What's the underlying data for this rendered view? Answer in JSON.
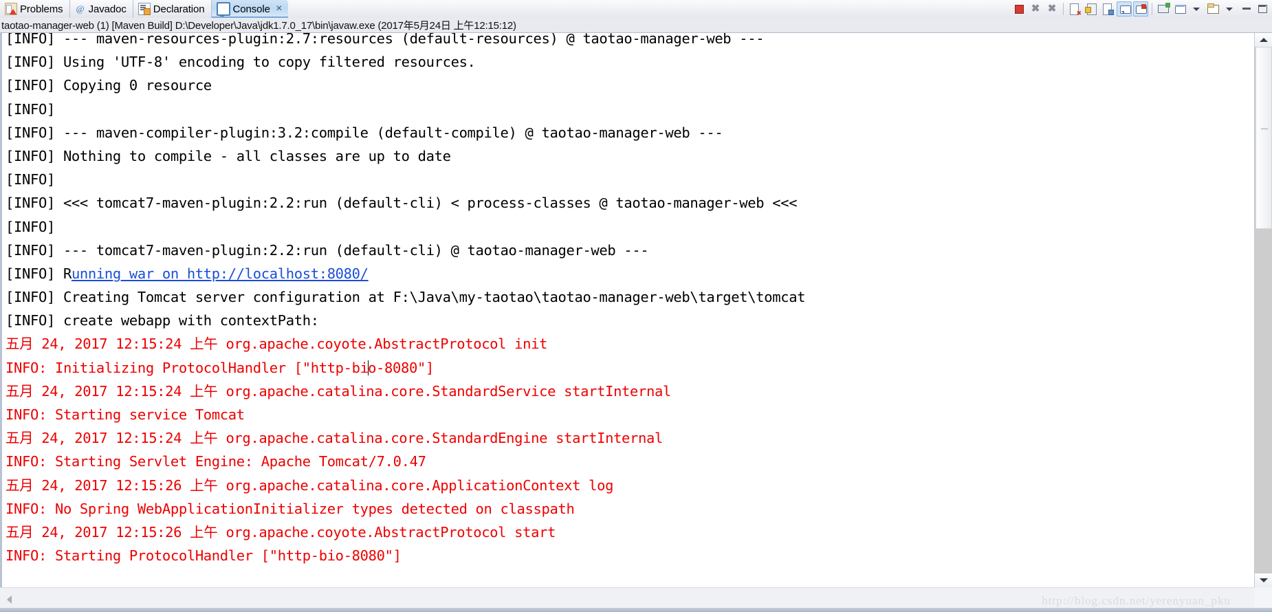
{
  "tabs": [
    {
      "label": "Problems",
      "icon": "problems-icon",
      "active": false
    },
    {
      "label": "Javadoc",
      "icon": "javadoc-at-icon",
      "active": false
    },
    {
      "label": "Declaration",
      "icon": "declaration-icon",
      "active": false
    },
    {
      "label": "Console",
      "icon": "console-monitor-icon",
      "active": true,
      "close_glyph": "✕"
    }
  ],
  "toolbar": {
    "buttons": [
      {
        "name": "terminate-button",
        "tooltip": "Terminate"
      },
      {
        "name": "remove-launch-button",
        "tooltip": "Remove Launch"
      },
      {
        "name": "remove-all-terminated-button",
        "tooltip": "Remove All Terminated Launches"
      },
      {
        "name": "clear-console-button",
        "tooltip": "Clear Console"
      },
      {
        "name": "scroll-lock-button",
        "tooltip": "Scroll Lock"
      },
      {
        "name": "word-wrap-button",
        "tooltip": "Word Wrap"
      },
      {
        "name": "show-console-on-output-button",
        "tooltip": "Show Console When Standard Out Changes"
      },
      {
        "name": "show-console-on-error-button",
        "tooltip": "Show Console When Standard Error Changes"
      },
      {
        "name": "pin-console-button",
        "tooltip": "Pin Console"
      },
      {
        "name": "display-selected-console-button",
        "tooltip": "Display Selected Console"
      },
      {
        "name": "display-selected-console-menu",
        "tooltip": "Display Selected Console Menu"
      },
      {
        "name": "open-console-button",
        "tooltip": "Open Console"
      },
      {
        "name": "open-console-menu",
        "tooltip": "Open Console Menu"
      },
      {
        "name": "minimize-button",
        "tooltip": "Minimize"
      },
      {
        "name": "maximize-button",
        "tooltip": "Maximize"
      }
    ]
  },
  "launch_config": {
    "text": "taotao-manager-web (1) [Maven Build] D:\\Developer\\Java\\jdk1.7.0_17\\bin\\javaw.exe (2017年5月24日 上午12:15:12)"
  },
  "console": {
    "lines": [
      {
        "id": "l1",
        "text": "[INFO] --- maven-resources-plugin:2.7:resources (default-resources) @ taotao-manager-web ---",
        "color": "black",
        "clipped": true
      },
      {
        "id": "l2",
        "text": "[INFO] Using 'UTF-8' encoding to copy filtered resources.",
        "color": "black"
      },
      {
        "id": "l3",
        "text": "[INFO] Copying 0 resource",
        "color": "black"
      },
      {
        "id": "l4",
        "text": "[INFO]",
        "color": "black"
      },
      {
        "id": "l5",
        "text": "[INFO] --- maven-compiler-plugin:3.2:compile (default-compile) @ taotao-manager-web ---",
        "color": "black"
      },
      {
        "id": "l6",
        "text": "[INFO] Nothing to compile - all classes are up to date",
        "color": "black"
      },
      {
        "id": "l7",
        "text": "[INFO]",
        "color": "black"
      },
      {
        "id": "l8",
        "text": "[INFO] <<< tomcat7-maven-plugin:2.2:run (default-cli) < process-classes @ taotao-manager-web <<<",
        "color": "black"
      },
      {
        "id": "l9",
        "text": "[INFO]",
        "color": "black"
      },
      {
        "id": "l10",
        "text": "[INFO] --- tomcat7-maven-plugin:2.2:run (default-cli) @ taotao-manager-web ---",
        "color": "black"
      },
      {
        "id": "l11",
        "text": "[INFO] R",
        "link_text": "unning war on http://localhost:8080/",
        "color": "black",
        "has_link": true
      },
      {
        "id": "l12",
        "text": "[INFO] Creating Tomcat server configuration at F:\\Java\\my-taotao\\taotao-manager-web\\target\\tomcat",
        "color": "black"
      },
      {
        "id": "l13",
        "text": "[INFO] create webapp with contextPath:",
        "color": "black"
      },
      {
        "id": "l14",
        "text": "五月 24, 2017 12:15:24 上午 org.apache.coyote.AbstractProtocol init",
        "color": "red"
      },
      {
        "id": "l15",
        "pre_caret": "INFO: Initializing ProtocolHandler [\"http-bi",
        "post_caret": "o-8080\"]",
        "color": "red",
        "has_caret": true
      },
      {
        "id": "l16",
        "text": "五月 24, 2017 12:15:24 上午 org.apache.catalina.core.StandardService startInternal",
        "color": "red"
      },
      {
        "id": "l17",
        "text": "INFO: Starting service Tomcat",
        "color": "red"
      },
      {
        "id": "l18",
        "text": "五月 24, 2017 12:15:24 上午 org.apache.catalina.core.StandardEngine startInternal",
        "color": "red"
      },
      {
        "id": "l19",
        "text": "INFO: Starting Servlet Engine: Apache Tomcat/7.0.47",
        "color": "red"
      },
      {
        "id": "l20",
        "text": "五月 24, 2017 12:15:26 上午 org.apache.catalina.core.ApplicationContext log",
        "color": "red"
      },
      {
        "id": "l21",
        "text": "INFO: No Spring WebApplicationInitializer types detected on classpath",
        "color": "red"
      },
      {
        "id": "l22",
        "text": "五月 24, 2017 12:15:26 上午 org.apache.coyote.AbstractProtocol start",
        "color": "red"
      },
      {
        "id": "l23",
        "text": "INFO: Starting ProtocolHandler [\"http-bio-8080\"]",
        "color": "red"
      }
    ],
    "colors": {
      "stdout": "#000000",
      "stderr": "#ee0000",
      "hyperlink": "#1a4ed8",
      "background": "#ffffff"
    }
  },
  "watermark": {
    "text": "http://blog.csdn.net/yerenyuan_pku"
  }
}
